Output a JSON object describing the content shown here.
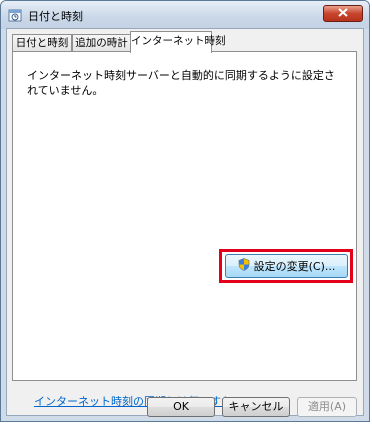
{
  "window": {
    "title": "日付と時刻"
  },
  "tabs": [
    {
      "label": "日付と時刻"
    },
    {
      "label": "追加の時計"
    },
    {
      "label": "インターネット時刻"
    }
  ],
  "panel": {
    "message": "インターネット時刻サーバーと自動的に同期するように設定されていません。",
    "change_settings_label": "設定の変更(C)...",
    "help_link": "インターネット時刻の同期とは何ですか?"
  },
  "buttons": {
    "ok": "OK",
    "cancel": "キャンセル",
    "apply": "適用(A)"
  },
  "colors": {
    "highlight": "#e3001b",
    "link": "#0066cc"
  },
  "icons": {
    "title": "clock-icon",
    "close": "close-icon",
    "shield": "uac-shield-icon"
  }
}
